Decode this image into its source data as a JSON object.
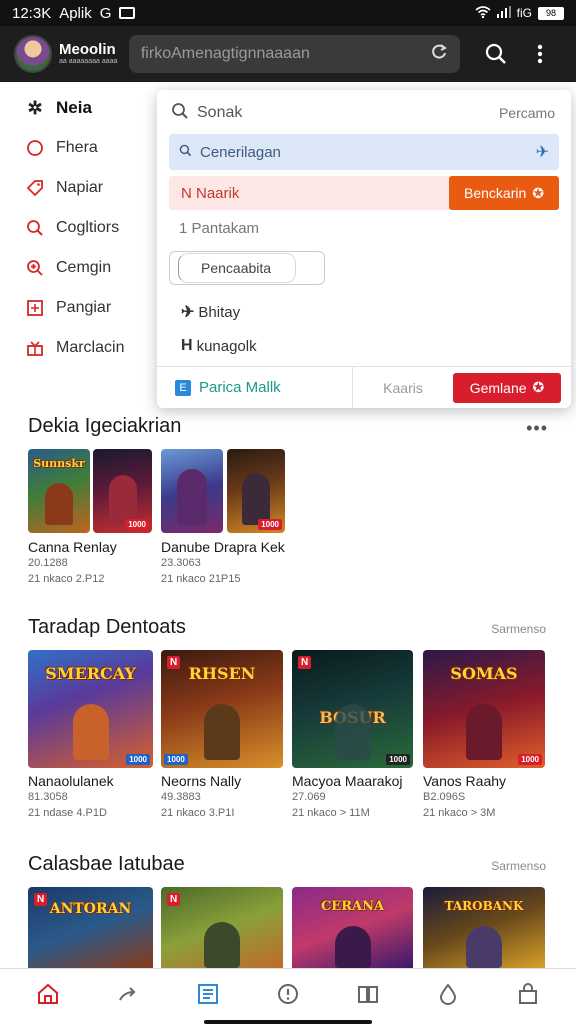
{
  "status_bar": {
    "time": "12:3K",
    "app_label": "Aplik",
    "g_label": "G",
    "net": "fiG",
    "battery": "98"
  },
  "app_bar": {
    "brand_name": "Meoolin",
    "brand_sub": "aa aaaaaaaa aaaa",
    "search_text": "firkoAmenagtignnaaaan"
  },
  "side_menu": [
    {
      "label": "Neia",
      "icon": "sparkle-icon"
    },
    {
      "label": "Fhera",
      "icon": "circle-icon"
    },
    {
      "label": "Napiar",
      "icon": "tag-icon"
    },
    {
      "label": "Cogltiors",
      "icon": "search-icon"
    },
    {
      "label": "Cemgin",
      "icon": "search-plus-icon"
    },
    {
      "label": "Pangiar",
      "icon": "grid-icon"
    },
    {
      "label": "Marclacin",
      "icon": "gift-icon"
    }
  ],
  "dropdown": {
    "search_label": "Sonak",
    "search_right": "Percamo",
    "row1": "Cenerilagan",
    "row2": "N Naarik",
    "row2_button": "Benckarin",
    "row3": "1 Pantakam",
    "input_value": "Pencaabita",
    "item1": "Bhitay",
    "item2": "kunagolk",
    "footer_link": "Parica Mallk",
    "footer_mid": "Kaaris",
    "footer_button": "Gemlane"
  },
  "sections": [
    {
      "title": "Dekia Igeciakrian",
      "more": "•••",
      "items": [
        {
          "title": "Canna Renlay",
          "sub1": "20.1288",
          "sub2": "21 nkaco 2.P12",
          "art": "Sunnskr",
          "badge": "1000"
        },
        {
          "title": "Danube Drapra Kek",
          "sub1": "23.3063",
          "sub2": "21 nkaco 21P15",
          "art": "",
          "badge": "1000"
        }
      ]
    },
    {
      "title": "Taradap Dentoats",
      "more": "Sarmenso",
      "items": [
        {
          "title": "Nanaolulanek",
          "sub1": "81.3058",
          "sub2": "21 ndase 4.P1D",
          "art": "SMERCAY",
          "badge": "1000"
        },
        {
          "title": "Neorns Nally",
          "sub1": "49.3883",
          "sub2": "21 nkaco 3.P1I",
          "art": "RHSEN",
          "badge": "1000"
        },
        {
          "title": "Macyoa Maarakoj",
          "sub1": "27.069",
          "sub2": "21 nkaco > 11M",
          "art": "BOSUR",
          "badge": "1000"
        },
        {
          "title": "Vanos Raahy",
          "sub1": "B2.096S",
          "sub2": "21 nkaco > 3M",
          "art": "SOMAS",
          "badge": "1000"
        }
      ]
    },
    {
      "title": "Calasbae Iatubae",
      "more": "Sarmenso",
      "items": [
        {
          "art": "ANTORAN"
        },
        {
          "art": ""
        },
        {
          "art": "CERANA"
        },
        {
          "art": "TAROBANK"
        }
      ]
    }
  ],
  "bottom_nav": [
    "home-icon",
    "share-icon",
    "list-icon",
    "alert-icon",
    "book-icon",
    "drop-icon",
    "bag-icon"
  ],
  "colors": {
    "accent_red": "#d81e2c",
    "accent_orange": "#ea5b12",
    "teal": "#1a9a8a",
    "app_bar": "#1e1e1e"
  }
}
